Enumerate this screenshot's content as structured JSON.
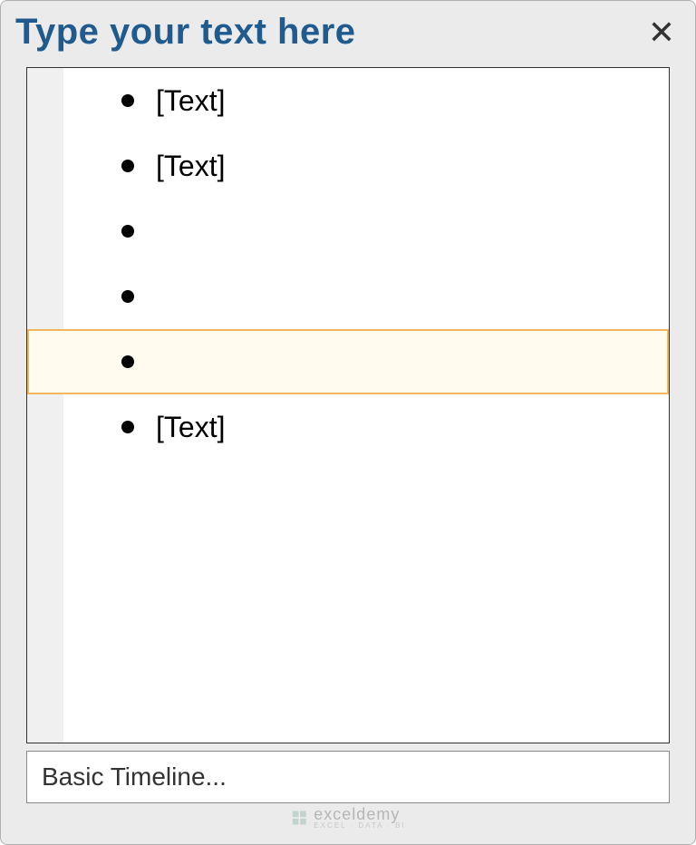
{
  "header": {
    "title": "Type your text here"
  },
  "list": {
    "items": [
      {
        "text": "[Text]",
        "selected": false
      },
      {
        "text": "[Text]",
        "selected": false
      },
      {
        "text": "",
        "selected": false
      },
      {
        "text": "",
        "selected": false
      },
      {
        "text": "",
        "selected": true
      },
      {
        "text": "[Text]",
        "selected": false
      }
    ]
  },
  "footer": {
    "label": "Basic Timeline..."
  },
  "watermark": {
    "main": "exceldemy",
    "sub": "EXCEL · DATA · BI"
  }
}
